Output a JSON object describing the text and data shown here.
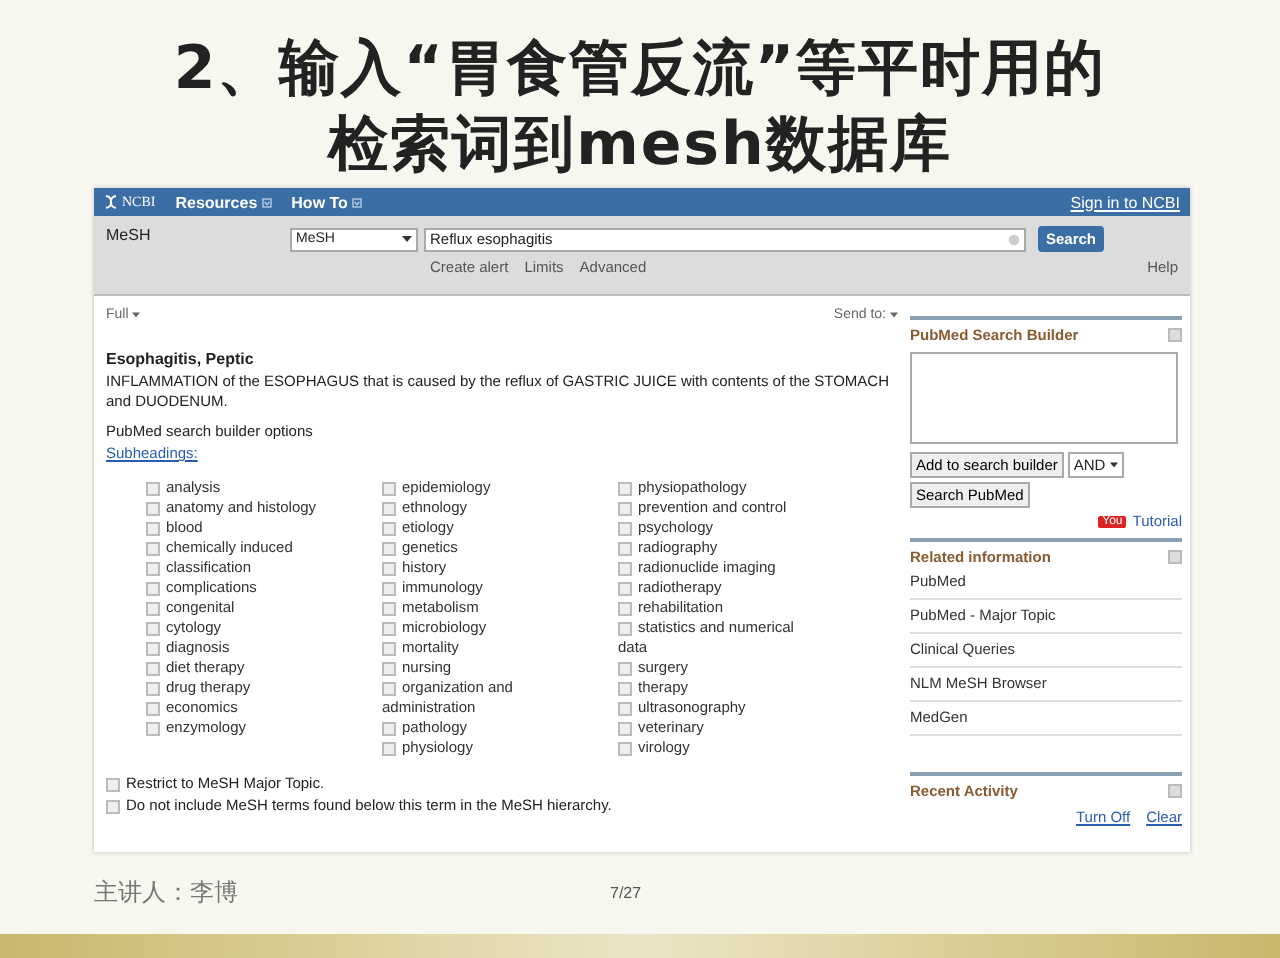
{
  "slide": {
    "title_lines": [
      "2、输入“胃食管反流”等平时用的",
      "检索词到mesh数据库"
    ],
    "speaker": "主讲人：李博",
    "page": "7/27"
  },
  "ncbi": {
    "logo": "NCBI",
    "menus": [
      "Resources",
      "How To"
    ],
    "sign_in": "Sign in to NCBI",
    "db_label": "MeSH",
    "db_select": "MeSH",
    "query": "Reflux esophagitis",
    "search_button": "Search",
    "sub_links": [
      "Create alert",
      "Limits",
      "Advanced"
    ],
    "help": "Help"
  },
  "content": {
    "format": "Full",
    "send_to": "Send to:",
    "term_title": "Esophagitis, Peptic",
    "definition": "INFLAMMATION of the ESOPHAGUS that is caused by the reflux of GASTRIC JUICE with contents of the STOMACH and DUODENUM.",
    "builder_options": "PubMed search builder options",
    "subheadings_link": "Subheadings:",
    "subheading_columns": [
      [
        {
          "label": "analysis",
          "checked": false
        },
        {
          "label": "anatomy and histology",
          "checked": false
        },
        {
          "label": "blood",
          "checked": false
        },
        {
          "label": "chemically induced",
          "checked": false
        },
        {
          "label": "classification",
          "checked": false
        },
        {
          "label": "complications",
          "checked": false
        },
        {
          "label": "congenital",
          "checked": false
        },
        {
          "label": "cytology",
          "checked": false
        },
        {
          "label": "diagnosis",
          "checked": false
        },
        {
          "label": "diet therapy",
          "checked": false
        },
        {
          "label": "drug therapy",
          "checked": false
        },
        {
          "label": "economics",
          "checked": false
        },
        {
          "label": "enzymology",
          "checked": false
        }
      ],
      [
        {
          "label": "epidemiology",
          "checked": false
        },
        {
          "label": "ethnology",
          "checked": false
        },
        {
          "label": "etiology",
          "checked": false
        },
        {
          "label": "genetics",
          "checked": false
        },
        {
          "label": "history",
          "checked": false
        },
        {
          "label": "immunology",
          "checked": false
        },
        {
          "label": "metabolism",
          "checked": false
        },
        {
          "label": "microbiology",
          "checked": false
        },
        {
          "label": "mortality",
          "checked": false
        },
        {
          "label": "nursing",
          "checked": false
        },
        {
          "label": "organization and administration",
          "checked": false
        },
        {
          "label": "pathology",
          "checked": false
        },
        {
          "label": "physiology",
          "checked": false
        }
      ],
      [
        {
          "label": "physiopathology",
          "checked": false
        },
        {
          "label": "prevention and control",
          "checked": false
        },
        {
          "label": "psychology",
          "checked": false
        },
        {
          "label": "radiography",
          "checked": false
        },
        {
          "label": "radionuclide imaging",
          "checked": false
        },
        {
          "label": "radiotherapy",
          "checked": false
        },
        {
          "label": "rehabilitation",
          "checked": false
        },
        {
          "label": "statistics and numerical data",
          "checked": false
        },
        {
          "label": "surgery",
          "checked": false
        },
        {
          "label": "therapy",
          "checked": false
        },
        {
          "label": "ultrasonography",
          "checked": false
        },
        {
          "label": "veterinary",
          "checked": false
        },
        {
          "label": "virology",
          "checked": false
        }
      ]
    ],
    "options": [
      {
        "label": "Restrict to MeSH Major Topic.",
        "checked": false
      },
      {
        "label": "Do not include MeSH terms found below this term in the MeSH hierarchy.",
        "checked": false
      }
    ]
  },
  "sidebar": {
    "builder_title": "PubMed Search Builder",
    "add_button": "Add to search builder",
    "operator": "AND",
    "search_pubmed": "Search PubMed",
    "video_badge": "You",
    "tutorial": "Tutorial",
    "related_title": "Related information",
    "related": [
      "PubMed",
      "PubMed - Major Topic",
      "Clinical Queries",
      "NLM MeSH Browser",
      "MedGen"
    ],
    "recent_title": "Recent Activity",
    "recent_links": [
      "Turn Off",
      "Clear"
    ]
  }
}
